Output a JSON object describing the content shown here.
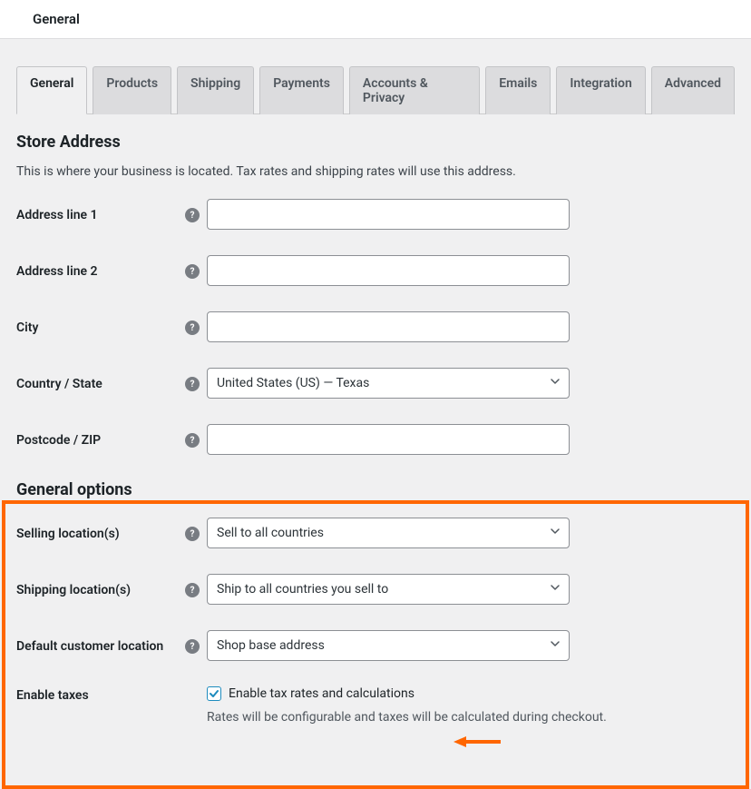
{
  "topBar": {
    "label": "General"
  },
  "tabs": [
    {
      "label": "General",
      "active": true
    },
    {
      "label": "Products",
      "active": false
    },
    {
      "label": "Shipping",
      "active": false
    },
    {
      "label": "Payments",
      "active": false
    },
    {
      "label": "Accounts & Privacy",
      "active": false
    },
    {
      "label": "Emails",
      "active": false
    },
    {
      "label": "Integration",
      "active": false
    },
    {
      "label": "Advanced",
      "active": false
    }
  ],
  "storeAddress": {
    "title": "Store Address",
    "desc": "This is where your business is located. Tax rates and shipping rates will use this address.",
    "fields": {
      "address1": {
        "label": "Address line 1",
        "value": ""
      },
      "address2": {
        "label": "Address line 2",
        "value": ""
      },
      "city": {
        "label": "City",
        "value": ""
      },
      "country": {
        "label": "Country / State",
        "value": "United States (US) — Texas"
      },
      "postcode": {
        "label": "Postcode / ZIP",
        "value": ""
      }
    }
  },
  "generalOptions": {
    "title": "General options",
    "fields": {
      "selling": {
        "label": "Selling location(s)",
        "value": "Sell to all countries"
      },
      "shipping": {
        "label": "Shipping location(s)",
        "value": "Ship to all countries you sell to"
      },
      "defaultLocation": {
        "label": "Default customer location",
        "value": "Shop base address"
      },
      "enableTaxes": {
        "label": "Enable taxes",
        "checkboxLabel": "Enable tax rates and calculations",
        "checked": true,
        "desc": "Rates will be configurable and taxes will be calculated during checkout."
      }
    }
  },
  "helpGlyph": "?"
}
